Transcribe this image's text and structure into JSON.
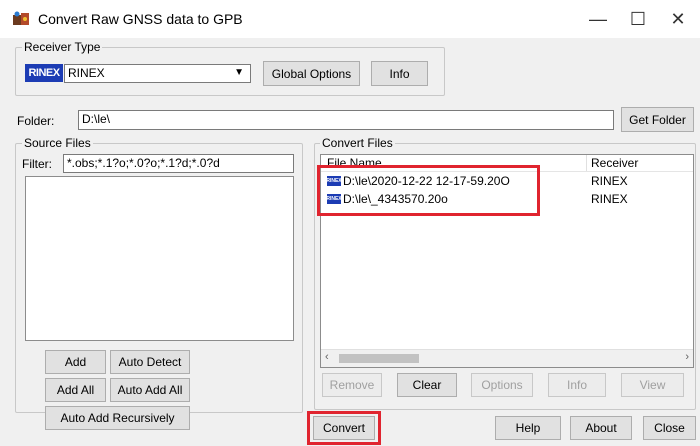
{
  "window": {
    "title": "Convert Raw GNSS data to GPB"
  },
  "receiver_type": {
    "label": "Receiver Type",
    "badge": "RINEX",
    "selected": "RINEX",
    "global_options_btn": "Global Options",
    "info_btn": "Info"
  },
  "folder": {
    "label": "Folder:",
    "value": "D:\\le\\",
    "get_folder_btn": "Get Folder"
  },
  "source_files": {
    "label": "Source Files",
    "filter_label": "Filter:",
    "filter_value": "*.obs;*.1?o;*.0?o;*.1?d;*.0?d",
    "add_btn": "Add",
    "auto_detect_btn": "Auto Detect",
    "add_all_btn": "Add All",
    "auto_add_all_btn": "Auto Add All",
    "auto_add_recursively_btn": "Auto Add Recursively"
  },
  "convert_files": {
    "label": "Convert Files",
    "columns": [
      "File Name",
      "Receiver"
    ],
    "rows": [
      {
        "file": "D:\\le\\2020-12-22 12-17-59.20O",
        "receiver": "RINEX"
      },
      {
        "file": "D:\\le\\_4343570.20o",
        "receiver": "RINEX"
      }
    ],
    "row_badge": "RINEX",
    "remove_btn": "Remove",
    "clear_btn": "Clear",
    "options_btn": "Options",
    "info_btn": "Info",
    "view_btn": "View"
  },
  "bottom": {
    "convert_btn": "Convert",
    "help_btn": "Help",
    "about_btn": "About",
    "close_btn": "Close"
  },
  "colors": {
    "highlight": "#e0242f",
    "badge": "#1c3cb4"
  }
}
